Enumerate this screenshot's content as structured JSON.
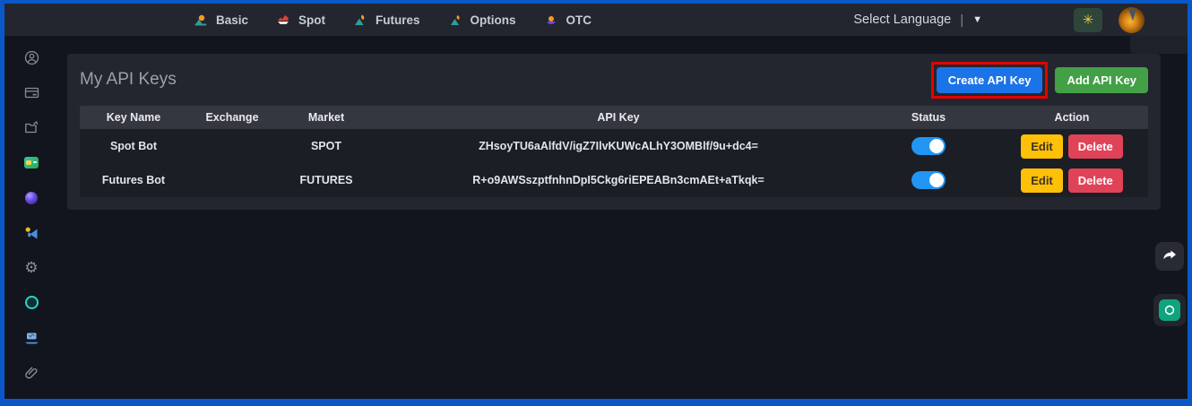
{
  "navbar": {
    "items": [
      {
        "label": "Basic",
        "icon": "basic-icon"
      },
      {
        "label": "Spot",
        "icon": "spot-icon"
      },
      {
        "label": "Futures",
        "icon": "futures-icon"
      },
      {
        "label": "Options",
        "icon": "options-icon"
      },
      {
        "label": "OTC",
        "icon": "otc-icon"
      }
    ],
    "language_label": "Select Language",
    "language_divider": "|",
    "language_caret": "▼",
    "theme_icon": "sun-icon",
    "theme_glyph": "✳",
    "logo_icon": "phoenix-logo"
  },
  "sidebar": {
    "icons": [
      "user-circle-icon",
      "card-icon",
      "folder-share-icon",
      "sim-card-icon",
      "orb-icon",
      "megaphone-icon",
      "gear-icon",
      "disc-icon",
      "workstation-icon",
      "paperclip-icon"
    ],
    "gear_glyph": "⚙"
  },
  "main": {
    "title": "My API Keys",
    "create_button_label": "Create API Key",
    "add_button_label": "Add API Key",
    "table": {
      "columns": [
        "Key Name",
        "Exchange",
        "Market",
        "API Key",
        "Status",
        "Action"
      ],
      "rows": [
        {
          "key_name": "Spot Bot",
          "exchange": "",
          "market": "SPOT",
          "api_key": "ZHsoyTU6aAlfdV/igZ7IlvKUWcALhY3OMBlf/9u+dc4=",
          "status": "on",
          "edit_label": "Edit",
          "delete_label": "Delete"
        },
        {
          "key_name": "Futures Bot",
          "exchange": "",
          "market": "FUTURES",
          "api_key": "R+o9AWSszptfnhnDpI5Ckg6riEPEABn3cmAEt+aTkqk=",
          "status": "on",
          "edit_label": "Edit",
          "delete_label": "Delete"
        }
      ]
    }
  },
  "colors": {
    "frame_border_blue": "#0a58c8",
    "accent_blue": "#1b73e8",
    "accent_green": "#43a047",
    "warning_yellow": "#ffc107",
    "danger_red": "#e04358",
    "toggle_blue": "#2196f3",
    "annotation_red": "#e60000",
    "chat_green": "#10a37f"
  }
}
